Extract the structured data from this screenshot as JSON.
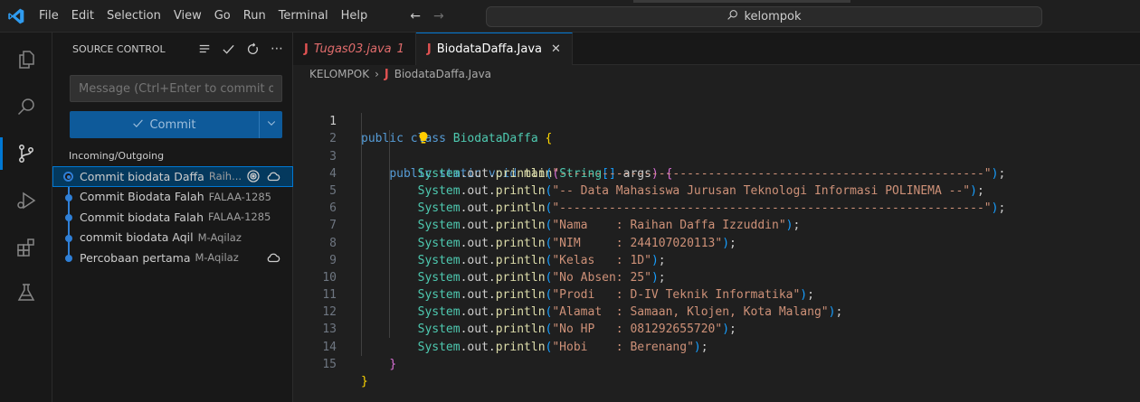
{
  "menu": [
    "File",
    "Edit",
    "Selection",
    "View",
    "Go",
    "Run",
    "Terminal",
    "Help"
  ],
  "search": {
    "text": "kelompok"
  },
  "sidebar": {
    "title": "SOURCE CONTROL",
    "message_placeholder": "Message (Ctrl+Enter to commit o...",
    "commit_label": "Commit",
    "graph_title": "Incoming/Outgoing",
    "commits": [
      {
        "message": "Commit biodata Daffa",
        "author": "Raih...",
        "selected": true
      },
      {
        "message": "Commit Biodata Falah",
        "author": "FALAA-1285"
      },
      {
        "message": "Commit biodata Falah",
        "author": "FALAA-1285"
      },
      {
        "message": "commit biodata Aqil",
        "author": "M-Aqilaz"
      },
      {
        "message": "Percobaan pertama",
        "author": "M-Aqilaz"
      }
    ]
  },
  "tabs": [
    {
      "label": "Tugas03.java",
      "badge": "1",
      "active": false
    },
    {
      "label": "BiodataDaffa.Java",
      "active": true
    }
  ],
  "breadcrumb": {
    "folder": "KELOMPOK",
    "file": "BiodataDaffa.Java"
  },
  "code": {
    "line_numbers": [
      "1",
      "2",
      "3",
      "4",
      "5",
      "6",
      "7",
      "8",
      "9",
      "10",
      "11",
      "12",
      "13",
      "14",
      "15"
    ],
    "class_name": "BiodataDaffa",
    "strings": [
      "\"------------------------------------------------------------\"",
      "\"-- Data Mahasiswa Jurusan Teknologi Informasi POLINEMA --\"",
      "\"------------------------------------------------------------\"",
      "\"Nama    : Raihan Daffa Izzuddin\"",
      "\"NIM     : 244107020113\"",
      "\"Kelas   : 1D\"",
      "\"No Absen: 25\"",
      "\"Prodi   : D-IV Teknik Informatika\"",
      "\"Alamat  : Samaan, Klojen, Kota Malang\"",
      "\"No HP   : 081292655720\"",
      "\"Hobi    : Berenang\""
    ]
  },
  "colors": {
    "accent": "#0078d4",
    "keyword": "#569cd6",
    "type": "#4ec9b0",
    "function": "#dcdcaa",
    "string": "#ce9178"
  }
}
